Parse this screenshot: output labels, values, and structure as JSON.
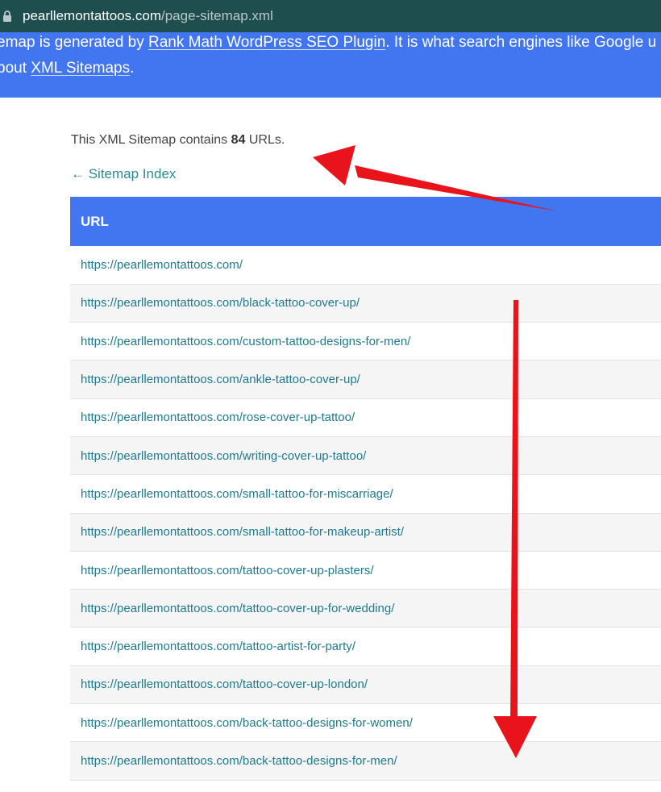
{
  "browser": {
    "domain": "pearllemontattoos.com",
    "path": "/page-sitemap.xml"
  },
  "header": {
    "line1_pre": "emap is generated by ",
    "line1_link": "Rank Math WordPress SEO Plugin",
    "line1_post": ". It is what search engines like Google u",
    "line2_pre": "bout ",
    "line2_link": "XML Sitemaps",
    "line2_post": "."
  },
  "summary": {
    "pre": "This XML Sitemap contains ",
    "count": "84",
    "post": " URLs."
  },
  "index_link": "← Sitemap Index",
  "table": {
    "column_header": "URL",
    "rows": [
      "https://pearllemontattoos.com/",
      "https://pearllemontattoos.com/black-tattoo-cover-up/",
      "https://pearllemontattoos.com/custom-tattoo-designs-for-men/",
      "https://pearllemontattoos.com/ankle-tattoo-cover-up/",
      "https://pearllemontattoos.com/rose-cover-up-tattoo/",
      "https://pearllemontattoos.com/writing-cover-up-tattoo/",
      "https://pearllemontattoos.com/small-tattoo-for-miscarriage/",
      "https://pearllemontattoos.com/small-tattoo-for-makeup-artist/",
      "https://pearllemontattoos.com/tattoo-cover-up-plasters/",
      "https://pearllemontattoos.com/tattoo-cover-up-for-wedding/",
      "https://pearllemontattoos.com/tattoo-artist-for-party/",
      "https://pearllemontattoos.com/tattoo-cover-up-london/",
      "https://pearllemontattoos.com/back-tattoo-designs-for-women/",
      "https://pearllemontattoos.com/back-tattoo-designs-for-men/"
    ]
  },
  "colors": {
    "accent_blue": "#4275f0",
    "link_teal": "#1e7a8c",
    "addressbar": "#1f4e4f",
    "annotation_red": "#e8131b"
  },
  "icons": {
    "addressbar": "lock-icon",
    "annotations": [
      "red-arrow-left-icon",
      "red-arrow-down-icon"
    ]
  }
}
